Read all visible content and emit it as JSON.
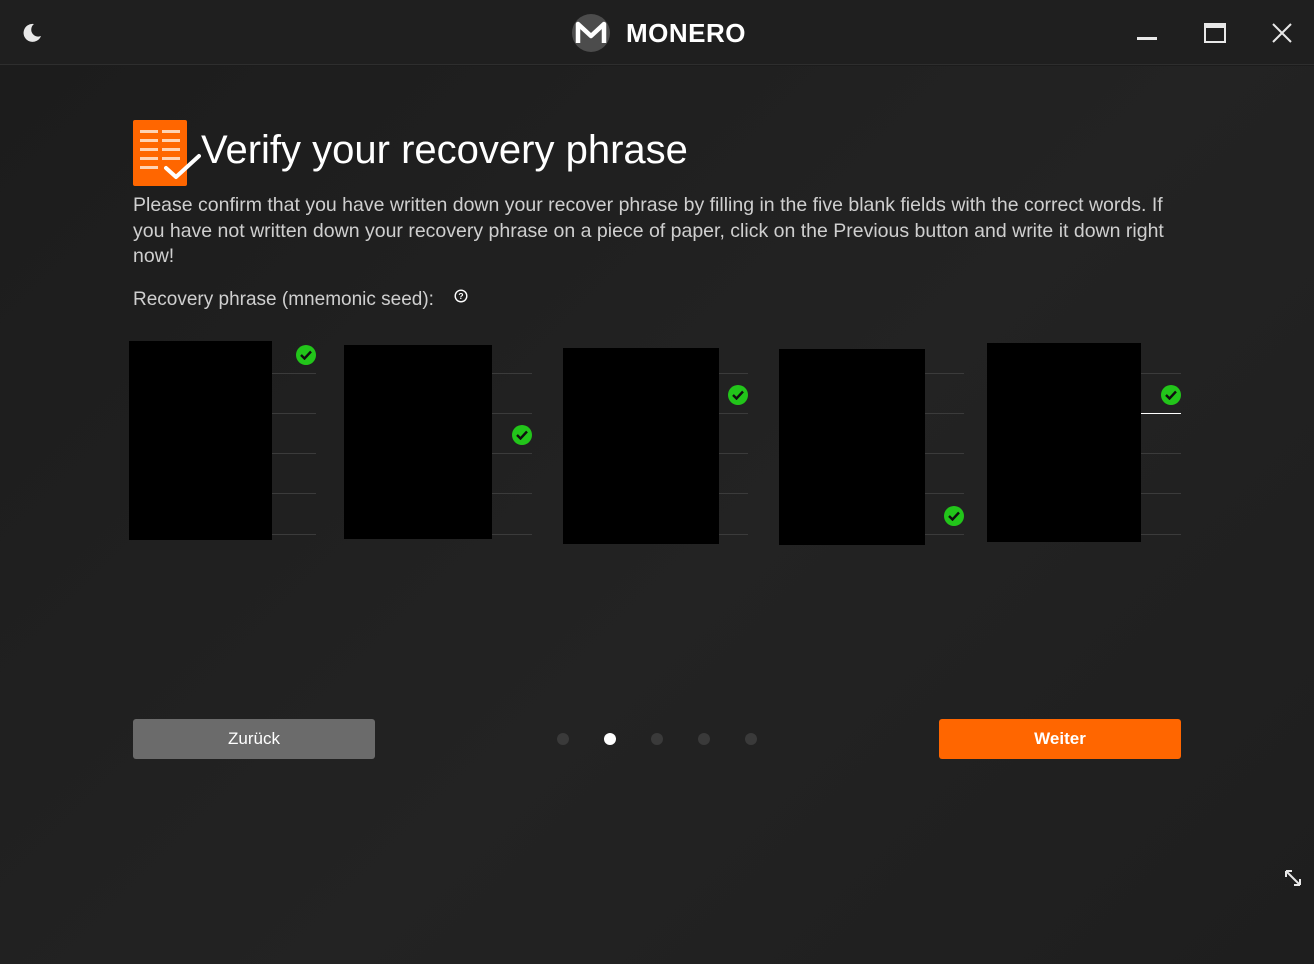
{
  "titlebar": {
    "brand": "MONERO",
    "icons": [
      "moon-icon",
      "monero-logo",
      "minimize-icon",
      "maximize-icon",
      "close-icon"
    ]
  },
  "page": {
    "title": "Verify your recovery phrase",
    "description": "Please confirm that you have written down your recover phrase by filling in the five blank fields with the correct words. If you have not written down your recovery phrase on a piece of paper, click on the Previous button and write it down right now!",
    "seed_label": "Recovery phrase (mnemonic seed):"
  },
  "seed_columns": [
    {
      "verified_row": 1,
      "status": "verified"
    },
    {
      "verified_row": 3,
      "status": "verified"
    },
    {
      "verified_row": 2,
      "status": "verified"
    },
    {
      "verified_row": 5,
      "status": "verified"
    },
    {
      "verified_row": 2,
      "status": "verified",
      "active": true
    }
  ],
  "navigation": {
    "back_label": "Zurück",
    "next_label": "Weiter",
    "step_count": 5,
    "current_step": 2
  },
  "colors": {
    "accent": "#ff6600",
    "check": "#22c51a",
    "background": "#1c1c1c",
    "back_button": "#6b6b6b"
  }
}
